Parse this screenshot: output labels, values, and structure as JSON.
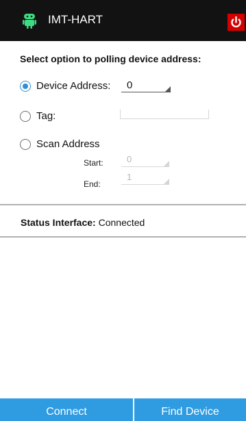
{
  "header": {
    "title": "IMT-HART",
    "app_icon": "android-robot-icon",
    "power_icon": "power-icon",
    "power_color": "#d40000",
    "background": "#121212"
  },
  "polling": {
    "title": "Select option to polling device address:",
    "options": [
      {
        "label": "Device Address:",
        "selected": true,
        "value": "0"
      },
      {
        "label": "Tag:",
        "selected": false,
        "value": ""
      },
      {
        "label": "Scan Address",
        "selected": false
      }
    ],
    "scan": {
      "start_label": "Start:",
      "start_value": "0",
      "end_label": "End:",
      "end_value": "1"
    }
  },
  "status": {
    "label": "Status Interface:",
    "value": "Connected"
  },
  "buttons": {
    "connect": "Connect",
    "find_device": "Find Device",
    "color": "#2f9be0"
  }
}
